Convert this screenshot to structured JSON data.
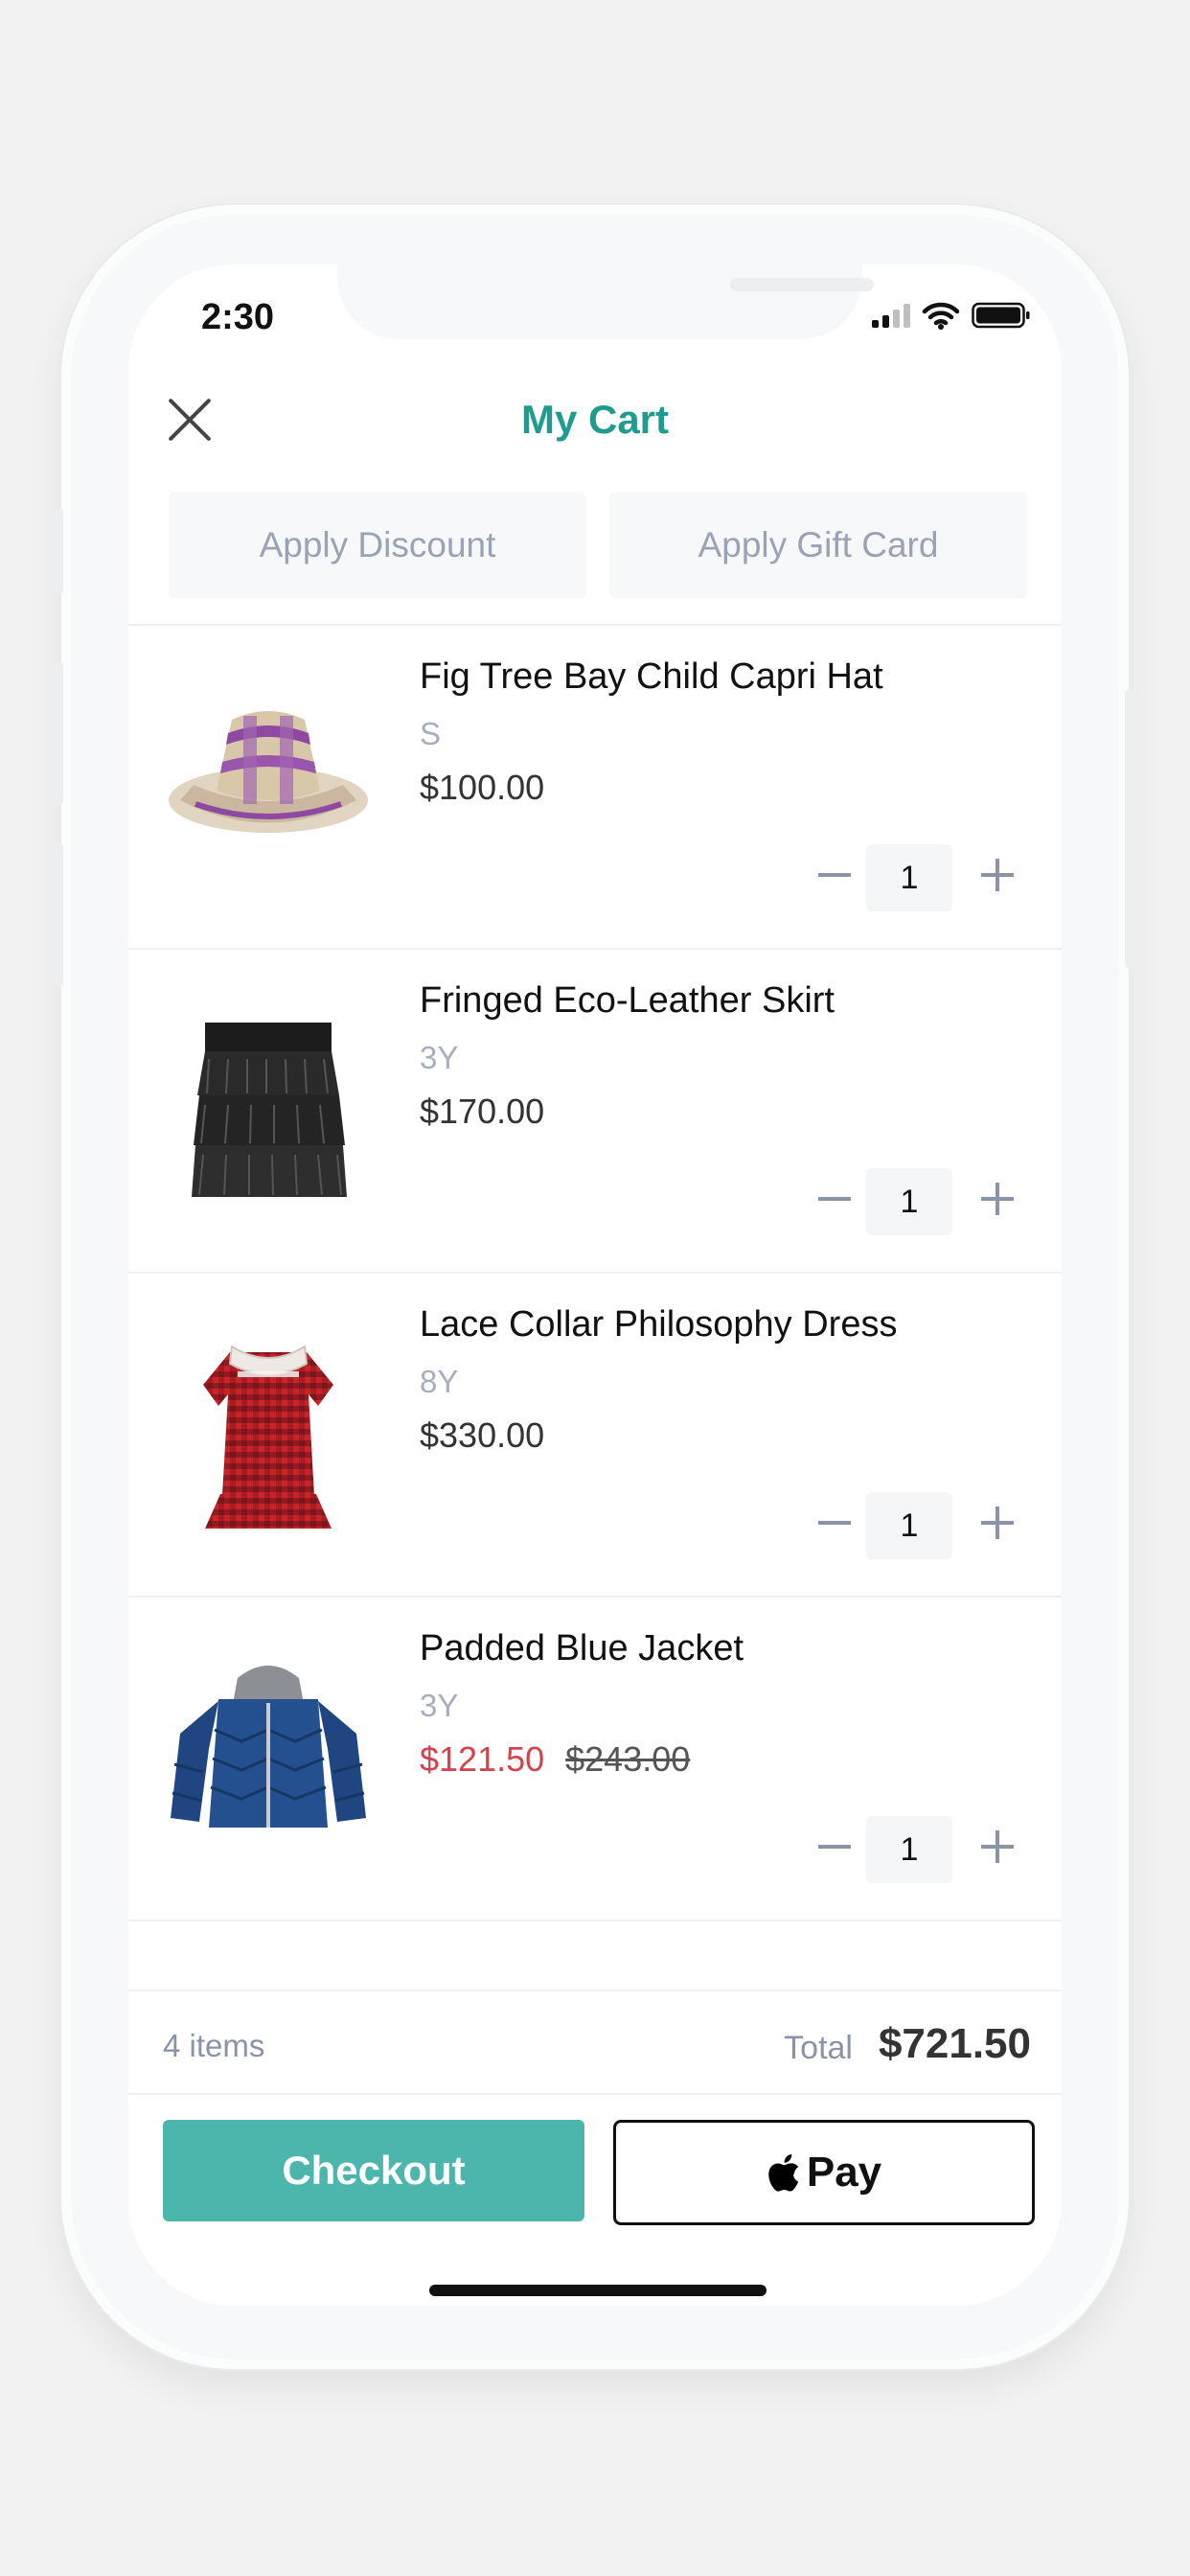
{
  "status_bar": {
    "time": "2:30"
  },
  "header": {
    "title": "My Cart"
  },
  "promos": {
    "discount_label": "Apply Discount",
    "gift_card_label": "Apply Gift Card"
  },
  "items": [
    {
      "name": "Fig Tree Bay Child Capri Hat",
      "size": "S",
      "price": "$100.00",
      "qty": "1"
    },
    {
      "name": "Fringed Eco-Leather Skirt",
      "size": "3Y",
      "price": "$170.00",
      "qty": "1"
    },
    {
      "name": "Lace Collar Philosophy Dress",
      "size": "8Y",
      "price": "$330.00",
      "qty": "1"
    },
    {
      "name": "Padded Blue Jacket",
      "size": "3Y",
      "sale_price": "$121.50",
      "original_price": "$243.00",
      "qty": "1"
    }
  ],
  "summary": {
    "count": "4 items",
    "total_label": "Total",
    "total_value": "$721.50"
  },
  "actions": {
    "checkout_label": "Checkout",
    "apple_pay_label": "Pay"
  },
  "colors": {
    "accent": "#1f9c8e",
    "checkout": "#4db6ac",
    "sale": "#d9414a"
  }
}
